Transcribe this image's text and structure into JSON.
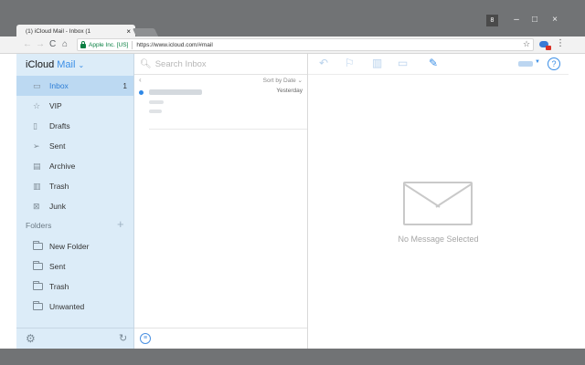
{
  "browser": {
    "tab_title": "(1) iCloud Mail - Inbox (1",
    "tab_close": "×",
    "user_badge": "8",
    "win_minimize": "–",
    "win_maximize": "□",
    "win_close": "×",
    "secure_label": "Apple Inc. [US]",
    "url": "https://www.icloud.com/#mail",
    "icons": [
      "back-arrow-icon",
      "forward-arrow-icon",
      "reload-icon",
      "home-icon",
      "lock-icon",
      "star-icon",
      "extension-icon",
      "menu-dots-icon"
    ]
  },
  "sidebar": {
    "brand_icloud": "iCloud",
    "brand_mail": "Mail",
    "brand_caret": "⌄",
    "mailboxes": [
      {
        "label": "Inbox",
        "count": "1",
        "icon": "inbox-icon",
        "active": true
      },
      {
        "label": "VIP",
        "icon": "star-icon"
      },
      {
        "label": "Drafts",
        "icon": "document-icon"
      },
      {
        "label": "Sent",
        "icon": "paper-plane-icon"
      },
      {
        "label": "Archive",
        "icon": "archive-box-icon"
      },
      {
        "label": "Trash",
        "icon": "trash-icon"
      },
      {
        "label": "Junk",
        "icon": "junk-icon"
      }
    ],
    "folders_heading": "Folders",
    "folders_add": "+",
    "folders": [
      {
        "label": "New Folder",
        "icon": "folder-icon"
      },
      {
        "label": "Sent",
        "icon": "folder-icon"
      },
      {
        "label": "Trash",
        "icon": "folder-icon"
      },
      {
        "label": "Unwanted",
        "icon": "folder-icon"
      }
    ]
  },
  "message_list": {
    "search_placeholder": "Search Inbox",
    "back": "‹",
    "sort_label": "Sort by Date ⌄",
    "messages": [
      {
        "date": "Yesterday",
        "unread": true
      }
    ]
  },
  "reader": {
    "toolbar_icons": [
      "reply-icon",
      "flag-icon",
      "trash-icon",
      "folder-move-icon",
      "compose-icon"
    ],
    "help": "?",
    "empty_text": "No Message Selected"
  },
  "colors": {
    "sidebar_bg": "#dcecf8",
    "active_item": "#bcd9f2",
    "accent": "#3a8ee6",
    "chrome": "#717375"
  }
}
